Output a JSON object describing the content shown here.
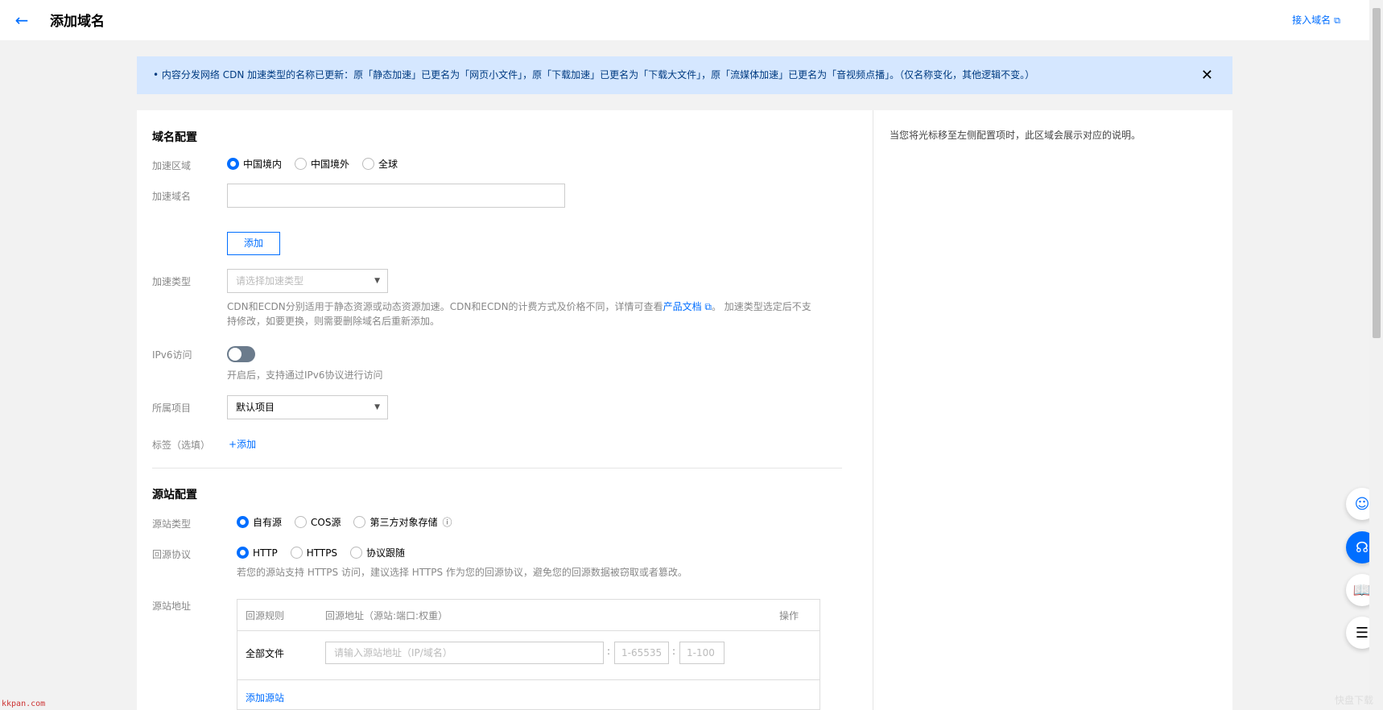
{
  "header": {
    "title": "添加域名",
    "link": "接入域名"
  },
  "notice": {
    "text": "• 内容分发网络 CDN 加速类型的名称已更新：原「静态加速」已更名为「网页小文件」，原「下载加速」已更名为「下载大文件」，原「流媒体加速」已更名为「音视频点播」。（仅名称变化，其他逻辑不变。）"
  },
  "domain": {
    "section": "域名配置",
    "region_label": "加速区域",
    "region_options": [
      "中国境内",
      "中国境外",
      "全球"
    ],
    "domain_label": "加速域名",
    "add_button": "添加",
    "type_label": "加速类型",
    "type_placeholder": "请选择加速类型",
    "type_desc_1": "CDN和ECDN分别适用于静态资源或动态资源加速。CDN和ECDN的计费方式及价格不同，详情可查看",
    "type_desc_link": "产品文档",
    "type_desc_2": "。 加速类型选定后不支",
    "type_desc_3": "持修改，如要更换，则需要删除域名后重新添加。",
    "ipv6_label": "IPv6访问",
    "ipv6_desc": "开启后，支持通过IPv6协议进行访问",
    "project_label": "所属项目",
    "project_value": "默认项目",
    "tag_label": "标签（选填）",
    "tag_add": "添加"
  },
  "origin": {
    "section": "源站配置",
    "type_label": "源站类型",
    "type_options": [
      "自有源",
      "COS源",
      "第三方对象存储"
    ],
    "proto_label": "回源协议",
    "proto_options": [
      "HTTP",
      "HTTPS",
      "协议跟随"
    ],
    "proto_desc": "若您的源站支持 HTTPS 访问，建议选择 HTTPS 作为您的回源协议，避免您的回源数据被窃取或者篡改。",
    "addr_label": "源站地址",
    "table": {
      "col_rule": "回源规则",
      "col_addr": "回源地址（源站:端口:权重）",
      "col_op": "操作",
      "row_rule": "全部文件",
      "addr_placeholder": "请输入源站地址（IP/域名）",
      "port_placeholder": "1-65535",
      "weight_placeholder": "1-100",
      "add_origin": "添加源站"
    }
  },
  "help": {
    "text": "当您将光标移至左侧配置项时，此区域会展示对应的说明。"
  },
  "watermark": {
    "left": "kkpan.com",
    "right": "快盘下载"
  }
}
